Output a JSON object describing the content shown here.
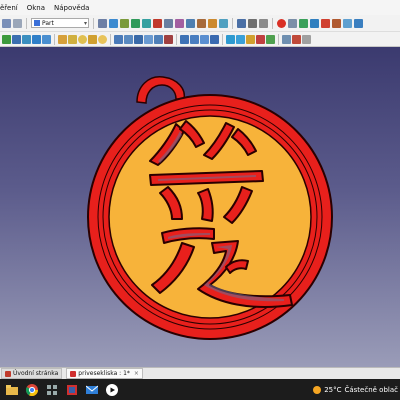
{
  "menu": {
    "items": [
      "ěření",
      "Okna",
      "Nápověda"
    ]
  },
  "toolbar": {
    "workbench_label": "Part"
  },
  "viewport": {
    "colors": {
      "outer_ring": "#e8201c",
      "fill": "#f7b33a",
      "edge": "#2a0000"
    }
  },
  "tabs": [
    {
      "label": "Úvodní stránka",
      "icon": "home-icon"
    },
    {
      "label": "privesekliska : 1*",
      "icon": "freecad-icon"
    }
  ],
  "taskbar": {
    "weather_temp": "25°C",
    "weather_text": "Částečně oblač"
  }
}
